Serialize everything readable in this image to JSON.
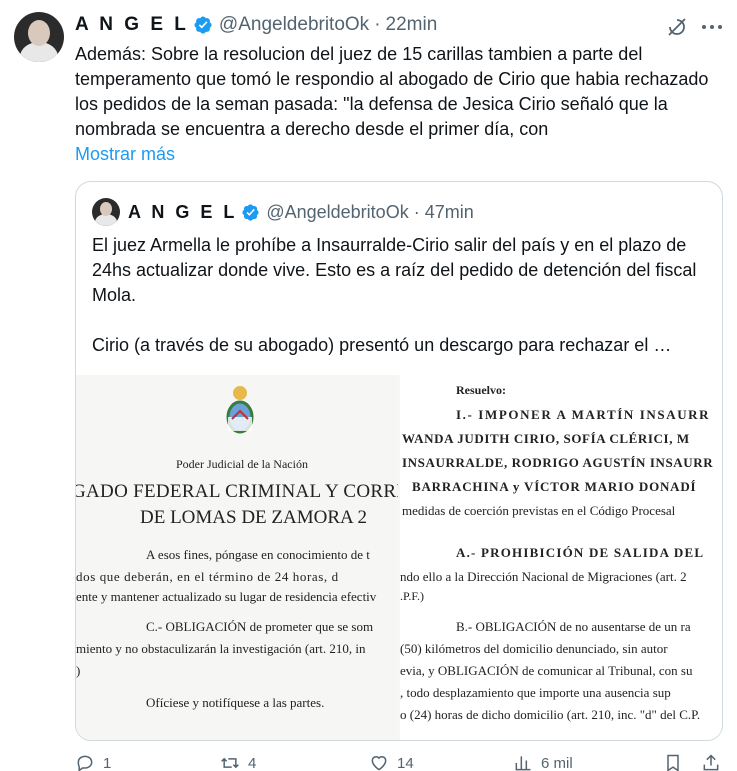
{
  "tweet": {
    "author_name": "A N G E L",
    "handle": "@AngeldebritoOk",
    "separator": "·",
    "time": "22min",
    "text": "Además: Sobre la resolucion del juez de 15 carillas tambien a parte del temperamento que tomó le respondio al abogado de Cirio que habia rechazado los pedidos de la seman pasada: \"la defensa de Jesica Cirio señaló que la nombrada se encuentra a derecho desde el primer día, con",
    "show_more": "Mostrar más"
  },
  "quote": {
    "author_name": "A N G E L",
    "handle": "@AngeldebritoOk",
    "separator": "·",
    "time": "47min",
    "text_p1": "El juez Armella le prohíbe a Insaurralde-Cirio salir del país y en el plazo de 24hs actualizar donde vive. Esto es a raíz del pedido de detención del fiscal Mola.",
    "text_p2": "Cirio (a través de su abogado) presentó un descargo para rechazar el …",
    "doc_left": {
      "org": "Poder Judicial de la Nación",
      "court_1": "GADO FEDERAL CRIMINAL Y CORRECCIO",
      "court_2": "DE LOMAS DE ZAMORA 2",
      "line_1": "A esos fines, póngase en conocimiento de t",
      "line_2": "dos que deberán, en el término de 24 horas, d",
      "line_3": "ente y mantener actualizado su lugar de residencia efectiv",
      "line_4": "C.- OBLIGACIÓN de prometer que se som",
      "line_5": "miento y no obstaculizarán la investigación (art. 210, in",
      "line_6": ")",
      "line_7": "Ofíciese y notifíquese a las partes."
    },
    "doc_right": {
      "r1": "Resuelvo:",
      "r2": "I.- IMPONER A MARTÍN INSAURR",
      "r3": "WANDA JUDITH CIRIO, SOFÍA CLÉRICI, M",
      "r4": "INSAURRALDE, RODRIGO AGUSTÍN INSAURR",
      "r5": "BARRACHINA y VÍCTOR MARIO DONADÍ",
      "r6": "medidas de coerción previstas en el Código Procesal",
      "r7": "A.- PROHIBICIÓN DE SALIDA DEL",
      "r8": "ndo ello a la Dirección Nacional de Migraciones (art. 2",
      "r9": ".P.F.)",
      "r10": "B.- OBLIGACIÓN de no ausentarse de un ra",
      "r11": "(50) kilómetros del domicilio denunciado, sin autor",
      "r12": "evia, y OBLIGACIÓN de comunicar al Tribunal, con su",
      "r13": ", todo desplazamiento que importe una ausencia sup",
      "r14": "o (24) horas de dicho domicilio (art. 210, inc. \"d\" del C.P."
    }
  },
  "actions": {
    "replies": "1",
    "reposts": "4",
    "likes": "14",
    "views": "6 mil"
  },
  "colors": {
    "text": "#0f1419",
    "secondary": "#536471",
    "link": "#1d9bf0",
    "border": "#cfd9de",
    "verified": "#1d9bf0"
  },
  "icons": [
    "verified-badge-icon",
    "grok-icon",
    "more-icon",
    "reply-icon",
    "repost-icon",
    "like-icon",
    "views-icon",
    "bookmark-icon",
    "share-icon",
    "coat-of-arms-icon"
  ]
}
